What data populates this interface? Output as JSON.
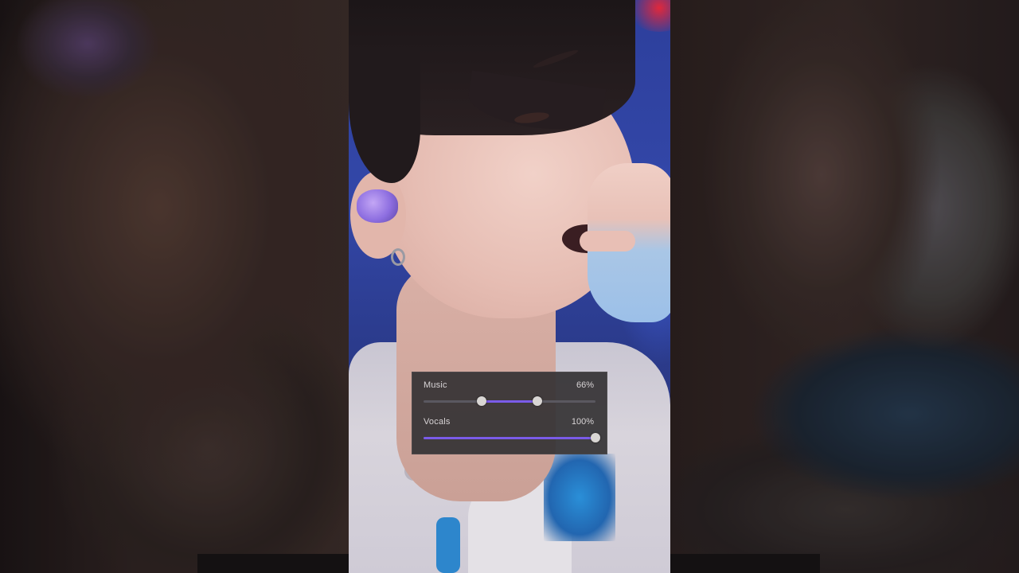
{
  "video": {
    "description_icon": "performer-video-frame"
  },
  "mixer": {
    "music": {
      "label": "Music",
      "value_text": "66%",
      "range_start": 0.34,
      "range_end": 0.66
    },
    "vocals": {
      "label": "Vocals",
      "value_text": "100%",
      "level": 1.0
    },
    "accent_color": "#7a5be8"
  }
}
